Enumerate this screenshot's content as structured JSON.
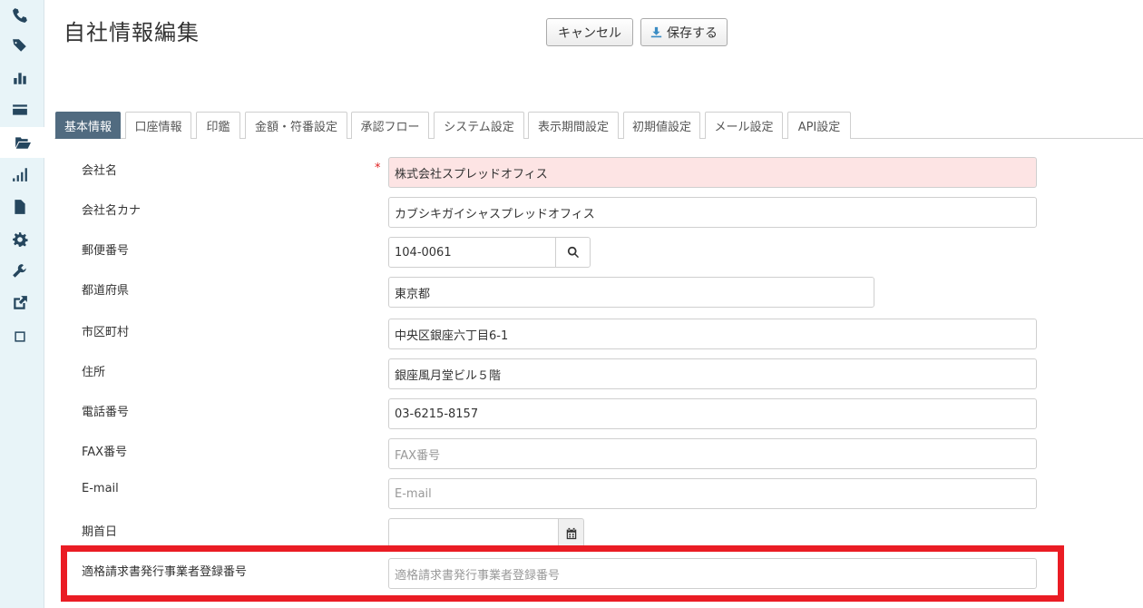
{
  "sidebar": {
    "icons": [
      "phone-icon",
      "tags-icon",
      "bar-chart-icon",
      "credit-card-icon",
      "folder-open-icon",
      "signal-icon",
      "file-icon",
      "gear-icon",
      "wrench-icon",
      "external-link-icon",
      "checkbox-icon"
    ]
  },
  "header": {
    "title": "自社情報編集",
    "cancel_label": "キャンセル",
    "save_label": "保存する"
  },
  "tabs": [
    {
      "label": "基本情報",
      "active": true
    },
    {
      "label": "口座情報"
    },
    {
      "label": "印鑑"
    },
    {
      "label": "金額・符番設定"
    },
    {
      "label": "承認フロー"
    },
    {
      "label": "システム設定"
    },
    {
      "label": "表示期間設定"
    },
    {
      "label": "初期値設定"
    },
    {
      "label": "メール設定"
    },
    {
      "label": "API設定"
    }
  ],
  "form": {
    "required_mark": "*",
    "company_name": {
      "label": "会社名",
      "value": "株式会社スプレッドオフィス"
    },
    "company_kana": {
      "label": "会社名カナ",
      "value": "カブシキガイシャスプレッドオフィス"
    },
    "postal_code": {
      "label": "郵便番号",
      "value": "104-0061"
    },
    "prefecture": {
      "label": "都道府県",
      "value": "東京都"
    },
    "city": {
      "label": "市区町村",
      "value": "中央区銀座六丁目6-1"
    },
    "address": {
      "label": "住所",
      "value": "銀座風月堂ビル５階"
    },
    "phone": {
      "label": "電話番号",
      "value": "03-6215-8157"
    },
    "fax": {
      "label": "FAX番号",
      "placeholder": "FAX番号"
    },
    "email": {
      "label": "E-mail",
      "placeholder": "E-mail"
    },
    "fiscal_start": {
      "label": "期首日",
      "value": ""
    },
    "invoice_reg": {
      "label": "適格請求書発行事業者登録番号",
      "placeholder": "適格請求書発行事業者登録番号"
    }
  },
  "colors": {
    "accent_tab": "#516b80",
    "highlight": "#ea1c24",
    "required_bg": "#fde4e4"
  }
}
